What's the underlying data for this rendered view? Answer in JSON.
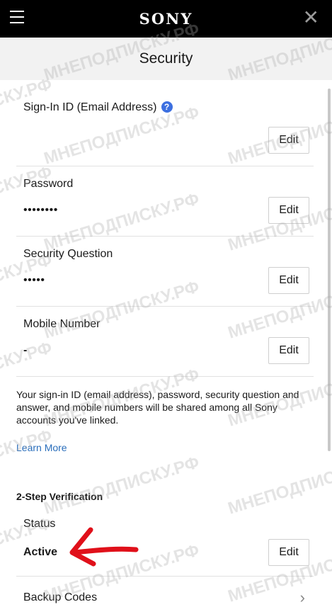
{
  "header": {
    "brand": "SONY",
    "close_glyph": "✕"
  },
  "page": {
    "title": "Security"
  },
  "rows": [
    {
      "label": "Sign-In ID (Email Address)",
      "value": "",
      "edit": "Edit"
    },
    {
      "label": "Password",
      "value": "••••••••",
      "edit": "Edit"
    },
    {
      "label": "Security Question",
      "value": "•••••",
      "edit": "Edit"
    },
    {
      "label": "Mobile Number",
      "value": "-",
      "edit": "Edit"
    }
  ],
  "help_glyph": "?",
  "info_text": "Your sign-in ID (email address), password, security question and answer, and mobile numbers will be shared among all Sony accounts you've linked.",
  "learn_more": "Learn More",
  "two_step": {
    "title": "2-Step Verification",
    "status_label": "Status",
    "status_value": "Active",
    "edit": "Edit"
  },
  "backup_codes": "Backup Codes",
  "watermark": "МНЕПОДПИСКУ.РФ",
  "colors": {
    "accent": "#3c6fe0",
    "link": "#2a6ebb",
    "arrow": "#e0101a",
    "topbar": "#000000"
  },
  "icons": [
    "menu-icon",
    "close-icon",
    "help-icon",
    "chevron-right-icon",
    "red-arrow-annotation"
  ]
}
